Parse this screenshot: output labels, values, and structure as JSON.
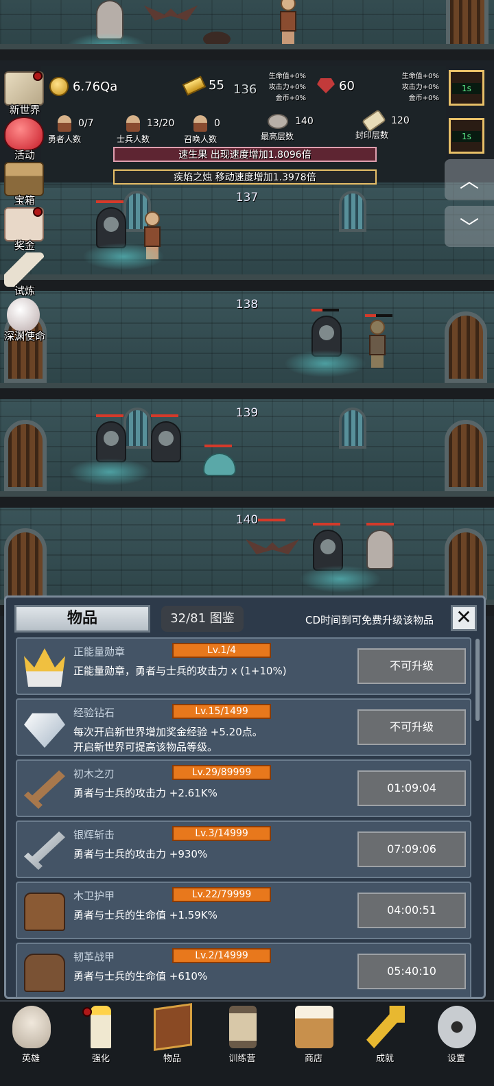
{
  "floors": [
    {
      "number": "136"
    },
    {
      "number": "137"
    },
    {
      "number": "138"
    },
    {
      "number": "139"
    },
    {
      "number": "140"
    }
  ],
  "hud": {
    "gold": "6.76Qa",
    "gold_bars": "55",
    "current_floor": "136",
    "rubies": "60",
    "bonus_left": {
      "hp": "生命值+0%",
      "atk": "攻击力+0%",
      "coin": "金币+0%"
    },
    "bonus_right": {
      "hp": "生命值+0%",
      "atk": "攻击力+0%",
      "coin": "金币+0%"
    },
    "heroes": {
      "value": "0/7",
      "label": "勇者人数"
    },
    "soldiers": {
      "value": "13/20",
      "label": "士兵人数"
    },
    "summons": {
      "value": "0",
      "label": "召唤人数"
    },
    "max_floor": {
      "value": "140",
      "label": "最高层数"
    },
    "seal_floor": {
      "value": "120",
      "label": "封印层数"
    },
    "buff_1": "速生果 出现速度增加1.8096倍",
    "buff_2": "疾焰之烛 移动速度增加1.3978倍"
  },
  "left_menu": [
    {
      "label": "新世界",
      "icon": "map-icon"
    },
    {
      "label": "活动",
      "icon": "heart-icon"
    },
    {
      "label": "宝箱",
      "icon": "chest-icon"
    },
    {
      "label": "奖金",
      "icon": "envelope-icon"
    },
    {
      "label": "试炼",
      "icon": "feather-icon"
    },
    {
      "label": "深渊使命",
      "icon": "orb-icon"
    }
  ],
  "timers": [
    "1s",
    "1s"
  ],
  "scroll": {
    "up": "︿",
    "down": "﹀"
  },
  "panel": {
    "title": "物品",
    "count": "32/81 图鉴",
    "note": "CD时间到可免费升级该物品",
    "close": "✕",
    "items": [
      {
        "name": "正能量勋章",
        "level": "Lv.1/4",
        "desc": "正能量勋章，勇者与士兵的攻击力 x (1+10%)",
        "button": "不可升级",
        "icon": "crown-icon"
      },
      {
        "name": "经验钻石",
        "level": "Lv.15/1499",
        "desc": "每次开启新世界增加奖金经验 +5.20点。\n开启新世界可提高该物品等级。",
        "button": "不可升级",
        "icon": "diamond-icon"
      },
      {
        "name": "初木之刃",
        "level": "Lv.29/89999",
        "desc": "勇者与士兵的攻击力 +2.61K%",
        "button": "01:09:04",
        "icon": "wooden-sword-icon"
      },
      {
        "name": "银辉斩击",
        "level": "Lv.3/14999",
        "desc": "勇者与士兵的攻击力 +930%",
        "button": "07:09:06",
        "icon": "silver-sword-icon"
      },
      {
        "name": "木卫护甲",
        "level": "Lv.22/79999",
        "desc": "勇者与士兵的生命值 +1.59K%",
        "button": "04:00:51",
        "icon": "wooden-armor-icon"
      },
      {
        "name": "韧革战甲",
        "level": "Lv.2/14999",
        "desc": "勇者与士兵的生命值 +610%",
        "button": "05:40:10",
        "icon": "leather-armor-icon"
      }
    ]
  },
  "bottom_nav": [
    {
      "label": "英雄",
      "icon": "skull-icon"
    },
    {
      "label": "强化",
      "icon": "candle-icon"
    },
    {
      "label": "物品",
      "icon": "book-icon"
    },
    {
      "label": "训练营",
      "icon": "lantern-icon"
    },
    {
      "label": "商店",
      "icon": "mug-icon"
    },
    {
      "label": "成就",
      "icon": "key-icon"
    },
    {
      "label": "设置",
      "icon": "gear-icon"
    }
  ],
  "colors": {
    "accent_orange": "#e8781c",
    "timer_green": "#5ef08a",
    "panel_bg": "#2d3a4a"
  }
}
